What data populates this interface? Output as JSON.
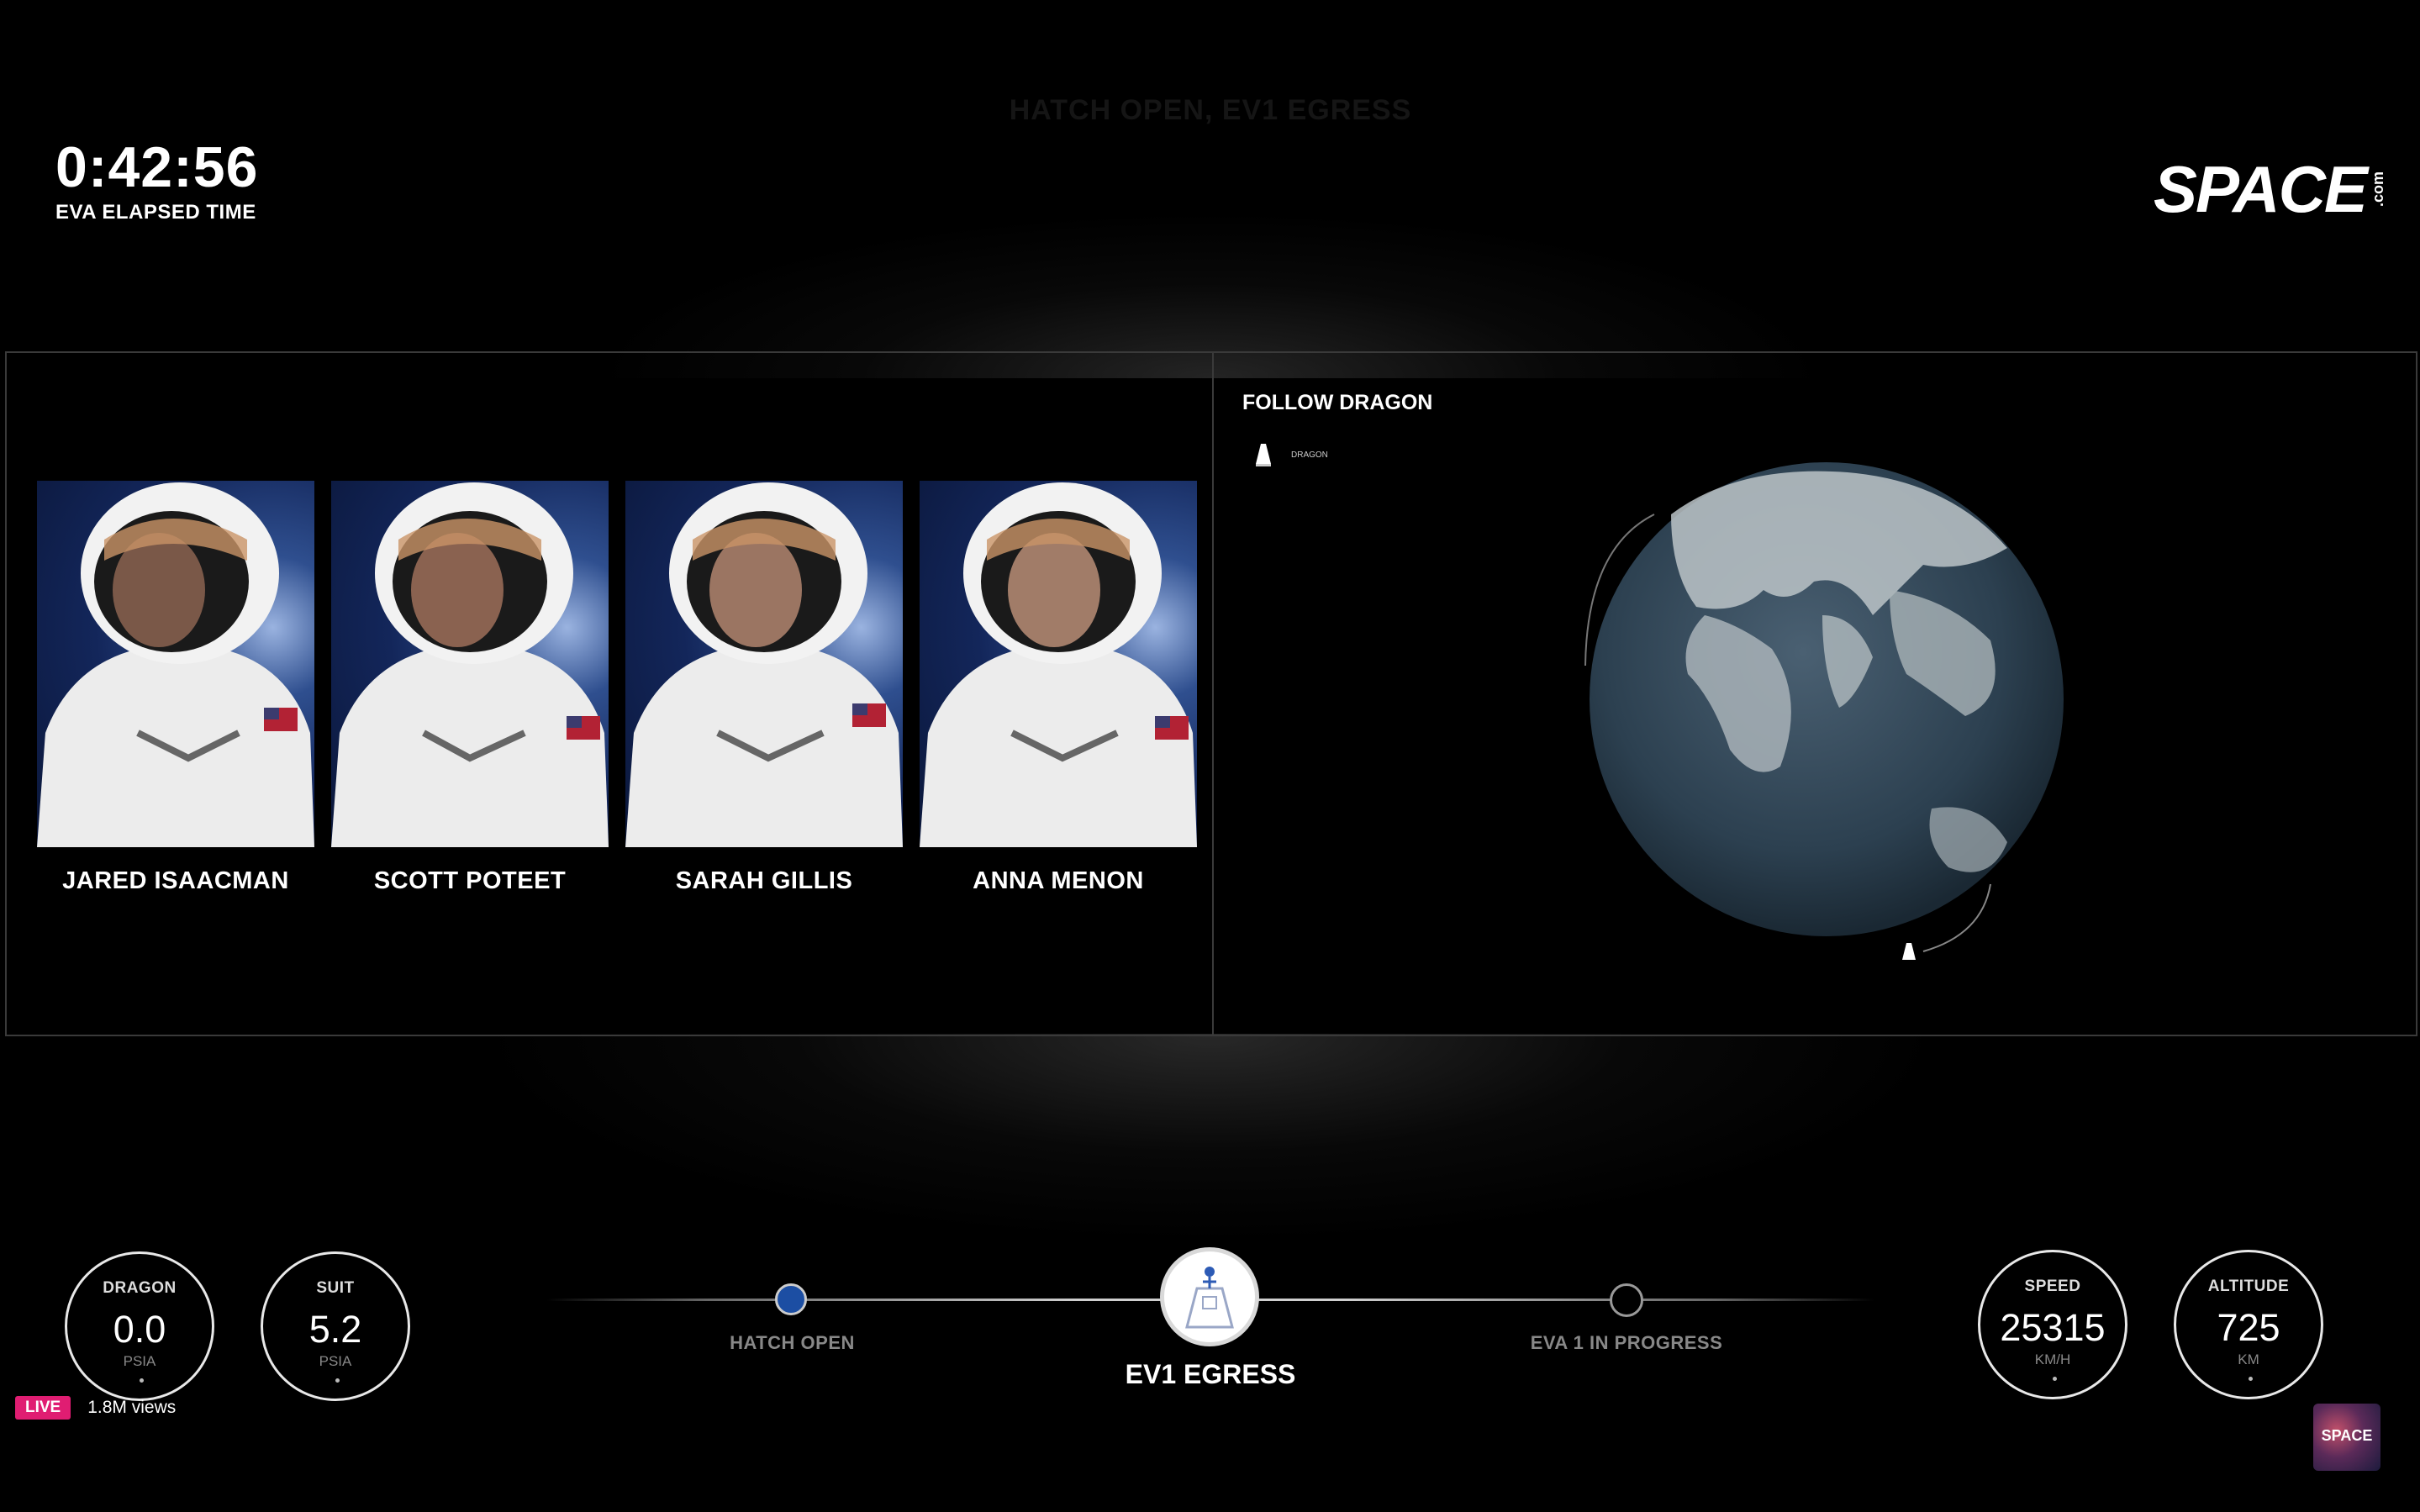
{
  "overlay": {
    "faint_title": "HATCH OPEN, EV1 EGRESS"
  },
  "clock": {
    "time": "0:42:56",
    "caption": "EVA ELAPSED TIME"
  },
  "brand": {
    "name": "SPACE",
    "suffix": ".com",
    "corner_badge": "SPACE"
  },
  "crew": [
    {
      "name": "JARED ISAACMAN"
    },
    {
      "name": "SCOTT POTEET"
    },
    {
      "name": "SARAH GILLIS"
    },
    {
      "name": "ANNA MENON"
    }
  ],
  "tracker": {
    "title": "FOLLOW DRAGON",
    "legend_label": "DRAGON"
  },
  "gauges": {
    "dragon": {
      "label": "DRAGON",
      "value": "0.0",
      "unit": "PSIA"
    },
    "suit": {
      "label": "SUIT",
      "value": "5.2",
      "unit": "PSIA"
    },
    "speed": {
      "label": "SPEED",
      "value": "25315",
      "unit": "KM/H"
    },
    "altitude": {
      "label": "ALTITUDE",
      "value": "725",
      "unit": "KM"
    }
  },
  "timeline": {
    "previous": "HATCH OPEN",
    "current": "EV1 EGRESS",
    "next": "EVA 1 IN PROGRESS"
  },
  "stream": {
    "live": "LIVE",
    "views": "1.8M views"
  },
  "colors": {
    "live_badge": "#e01d72",
    "hatch_node": "#1c4ea3",
    "suit_backdrop": "#13265a"
  }
}
